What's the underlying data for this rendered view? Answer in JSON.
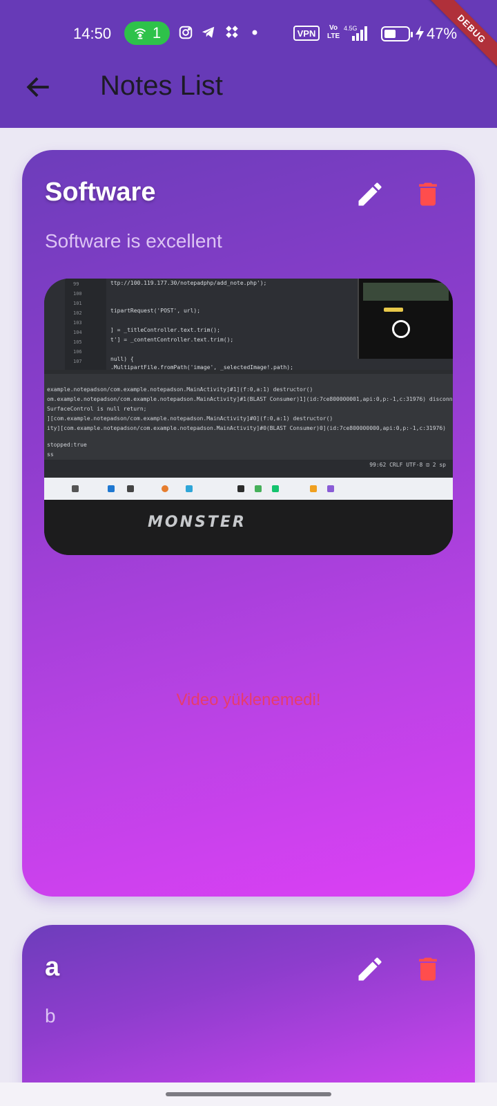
{
  "status_bar": {
    "time": "14:50",
    "hotspot_count": "1",
    "vpn_label": "VPN",
    "volte_top": "Vo",
    "volte_bottom": "LTE",
    "network_speed": "4.5G",
    "battery_percent": "47%",
    "battery_level": 0.47,
    "icons": [
      "hotspot-icon",
      "instagram-icon",
      "telegram-icon",
      "app-icon",
      "dot-icon",
      "signal-icon",
      "battery-icon",
      "charging-icon"
    ]
  },
  "debug_banner": "DEBUG",
  "app_bar": {
    "title": "Notes List",
    "back_icon": "arrow-left-icon"
  },
  "notes": [
    {
      "title": "Software",
      "content": "Software is excellent",
      "edit_icon": "pencil-icon",
      "delete_icon": "trash-icon",
      "has_image": true,
      "video_error": "Video yüklenemedi!"
    },
    {
      "title": "a",
      "content": "b",
      "edit_icon": "pencil-icon",
      "delete_icon": "trash-icon"
    }
  ],
  "colors": {
    "app_bar": "#673ab7",
    "background": "#ebe8f4",
    "card_gradient_start": "#6d3dbb",
    "card_gradient_end": "#dc40f5",
    "delete": "#ff4d4d",
    "video_error": "#e63c6e"
  }
}
